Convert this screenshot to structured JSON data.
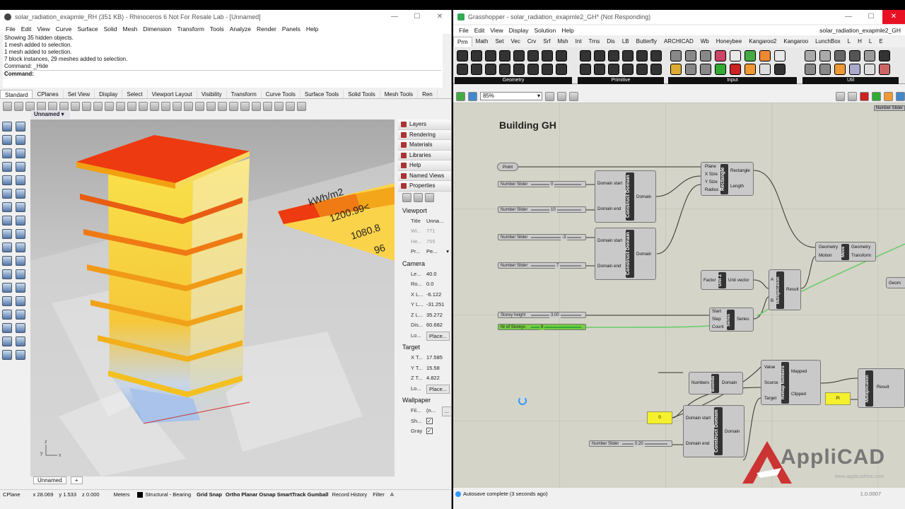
{
  "rhino": {
    "title": "solar_radiation_exapmle_RH (351 KB) - Rhinoceros 6 Not For Resale Lab - [Unnamed]",
    "menu": [
      "File",
      "Edit",
      "View",
      "Curve",
      "Surface",
      "Solid",
      "Mesh",
      "Dimension",
      "Transform",
      "Tools",
      "Analyze",
      "Render",
      "Panels",
      "Help"
    ],
    "cmd_lines": [
      "Showing 35 hidden objects.",
      "1 mesh added to selection.",
      "1 mesh added to selection.",
      "7 block instances, 29 meshes added to selection.",
      "Command: _Hide"
    ],
    "cmd_prompt": "Command:",
    "tabs": [
      "Standard",
      "CPlanes",
      "Set View",
      "Display",
      "Select",
      "Viewport Layout",
      "Visibility",
      "Transform",
      "Curve Tools",
      "Surface Tools",
      "Solid Tools",
      "Mesh Tools",
      "Ren"
    ],
    "viewport_name": "Unnamed",
    "viewport_tab": "Unnamed",
    "legend": {
      "unit": "kWh/m2",
      "v1": "1200.99<",
      "v2": "1080.8",
      "v3": "96"
    },
    "panel_items": [
      "Layers",
      "Rendering",
      "Materials",
      "Libraries",
      "Help",
      "Named Views",
      "Properties"
    ],
    "viewport_section": "Viewport",
    "vp_rows": [
      {
        "k": "Title",
        "v": "Unna..."
      },
      {
        "k": "Wi...",
        "v": "771",
        "g": true
      },
      {
        "k": "He...",
        "v": "755",
        "g": true
      },
      {
        "k": "Pr...",
        "v": "Pe..."
      }
    ],
    "camera_section": "Camera",
    "cam_rows": [
      {
        "k": "Le...",
        "v": "40.0"
      },
      {
        "k": "Ro...",
        "v": "0.0"
      },
      {
        "k": "X L...",
        "v": "-6.122"
      },
      {
        "k": "Y L...",
        "v": "-31.251"
      },
      {
        "k": "Z L...",
        "v": "35.272"
      },
      {
        "k": "Dis...",
        "v": "60.682"
      },
      {
        "k": "Lo...",
        "v": "Place..."
      }
    ],
    "target_section": "Target",
    "tgt_rows": [
      {
        "k": "X T...",
        "v": "17.585"
      },
      {
        "k": "Y T...",
        "v": "15.58"
      },
      {
        "k": "Z T...",
        "v": "4.822"
      },
      {
        "k": "Lo...",
        "v": "Place..."
      }
    ],
    "wallpaper_section": "Wallpaper",
    "wp_rows": [
      {
        "k": "Fil...",
        "v": "(n..."
      },
      {
        "k": "Sh...",
        "v": ""
      },
      {
        "k": "Gray",
        "v": ""
      }
    ],
    "status": {
      "plane": "CPlane",
      "x": "x 28.069",
      "y": "y 1.533",
      "z": "z 0.000",
      "units": "Meters",
      "layer": "Structural - Bearing",
      "snaps": [
        "Grid Snap",
        "Ortho",
        "Planar",
        "Osnap",
        "SmartTrack",
        "Gumball"
      ],
      "record": "Record History",
      "filter": "Filter",
      "a": "A"
    }
  },
  "gh": {
    "title": "Grasshopper - solar_radiation_exapmle2_GH* (Not Responding)",
    "doc_name": "solar_radiation_exapmle2_GH",
    "menu": [
      "File",
      "Edit",
      "View",
      "Display",
      "Solution",
      "Help"
    ],
    "tabs": [
      "Prm",
      "Math",
      "Set",
      "Vec",
      "Crv",
      "Srf",
      "Msh",
      "Int",
      "Trns",
      "Dis",
      "LB",
      "Butterfly",
      "ARCHICAD",
      "Wb",
      "Honeybee",
      "Kangaroo2",
      "Kangaroo",
      "LunchBox",
      "L",
      "H",
      "L",
      "E"
    ],
    "groups": [
      "Geometry",
      "Primitive",
      "Input",
      "Util"
    ],
    "zoom": "85%",
    "corner_label": "Number Slider",
    "group_title": "Building GH",
    "nodes": {
      "point": "Point",
      "rect": {
        "name": "Rectangle",
        "in": [
          "Plane",
          "X Size",
          "Y Size",
          "Radius"
        ],
        "out": [
          "Rectangle",
          "Length"
        ]
      },
      "cd1": {
        "name": "Construct Domain",
        "in": [
          "Domain start",
          "Domain end"
        ],
        "out": "Domain"
      },
      "cd2": {
        "name": "Construct Domain",
        "in": [
          "Domain start",
          "Domain end"
        ],
        "out": "Domain"
      },
      "move": {
        "name": "Move",
        "in": [
          "Geometry",
          "Motion"
        ],
        "out": [
          "Geometry",
          "Transform"
        ]
      },
      "unitz": {
        "name": "Unit Z",
        "in": "Factor",
        "out": "Unit vector"
      },
      "mult1": {
        "name": "Multiplication",
        "in": [
          "A",
          "B"
        ],
        "out": "Result"
      },
      "series": {
        "name": "Series",
        "in": [
          "Start",
          "Step",
          "Count"
        ],
        "out": "Series"
      },
      "bounds": {
        "name": "Bounds",
        "in": "Numbers",
        "out": "Domain"
      },
      "remap": {
        "name": "Remap Numbers",
        "in": [
          "Value",
          "Source",
          "Target"
        ],
        "out": [
          "Mapped",
          "Clipped"
        ]
      },
      "cd3": {
        "name": "Construct Domain",
        "in": [
          "Domain start",
          "Domain end"
        ],
        "out": "Domain"
      },
      "mult2": {
        "name": "Multiplication",
        "out": "Result"
      },
      "geom": "Geom"
    },
    "sliders": [
      {
        "label": "Number Slider",
        "value": "0"
      },
      {
        "label": "Number Slider",
        "value": "10"
      },
      {
        "label": "Number Slider",
        "value": "-3"
      },
      {
        "label": "Number Slider",
        "value": "7"
      },
      {
        "label": "Storey height",
        "value": "3.00"
      },
      {
        "label": "Nr of Storeys",
        "value": "8"
      },
      {
        "label": "Number Slider",
        "value": "0.20"
      }
    ],
    "panels": [
      "0",
      "Pi"
    ],
    "status": "Autosave complete (3 seconds ago)",
    "version": "1.0.0007",
    "watermark": "AppliCAD",
    "watermark_sub": "www.applicadthai.com"
  }
}
